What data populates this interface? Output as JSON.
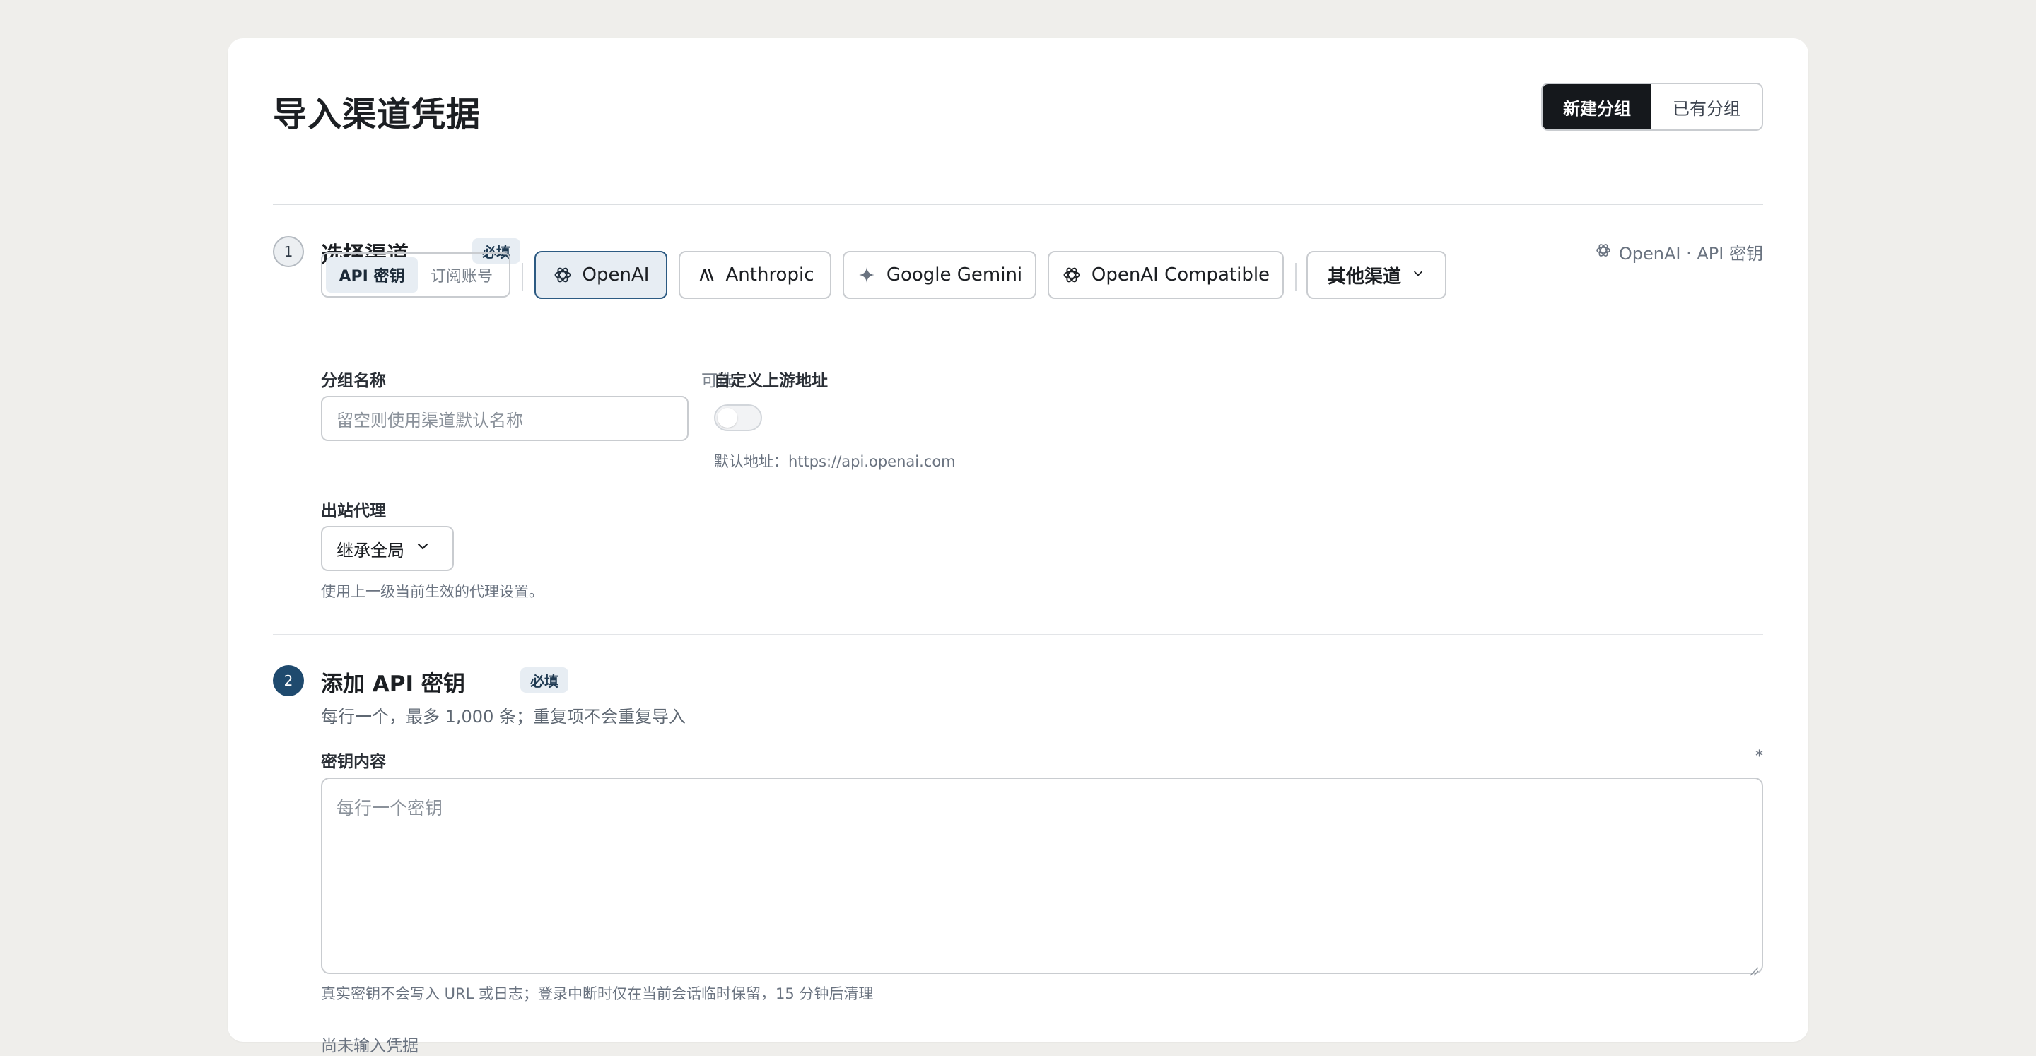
{
  "header": {
    "title": "导入渠道凭据",
    "group_mode": {
      "new_label": "新建分组",
      "existing_label": "已有分组",
      "selected": "新建分组"
    }
  },
  "step1": {
    "number": "1",
    "title": "选择渠道",
    "badge": "必填",
    "summary": "OpenAI · API 密钥",
    "auth_modes": {
      "api_key": "API 密钥",
      "subscription": "订阅账号",
      "selected": "API 密钥"
    },
    "channels": [
      {
        "label": "OpenAI",
        "icon": "openai-icon",
        "selected": true
      },
      {
        "label": "Anthropic",
        "icon": "anthropic-icon",
        "selected": false
      },
      {
        "label": "Google Gemini",
        "icon": "gemini-sparkle-icon",
        "selected": false
      },
      {
        "label": "OpenAI Compatible",
        "icon": "openai-icon",
        "selected": false
      }
    ],
    "more_channels": "其他渠道",
    "group_name": {
      "label": "分组名称",
      "optional": "可选",
      "placeholder": "留空则使用渠道默认名称",
      "value": ""
    },
    "custom_upstream": {
      "label": "自定义上游地址",
      "enabled": false,
      "help": "默认地址：https://api.openai.com"
    },
    "proxy": {
      "label": "出站代理",
      "value": "继承全局",
      "help": "使用上一级当前生效的代理设置。"
    }
  },
  "step2": {
    "number": "2",
    "title": "添加 API 密钥",
    "badge": "必填",
    "subtitle": "每行一个，最多 1,000 条；重复项不会重复导入",
    "key_field": {
      "label": "密钥内容",
      "required_mark": "*",
      "placeholder": "每行一个密钥",
      "value": ""
    },
    "note": "真实密钥不会写入 URL 或日志；登录中断时仅在当前会话临时保留，15 分钟后清理",
    "empty_state": "尚未输入凭据"
  },
  "colors": {
    "background": "#efeeeb",
    "accent": "#1f4a6e",
    "selected_fill": "#e7edf3",
    "dark_button": "#15181c"
  }
}
